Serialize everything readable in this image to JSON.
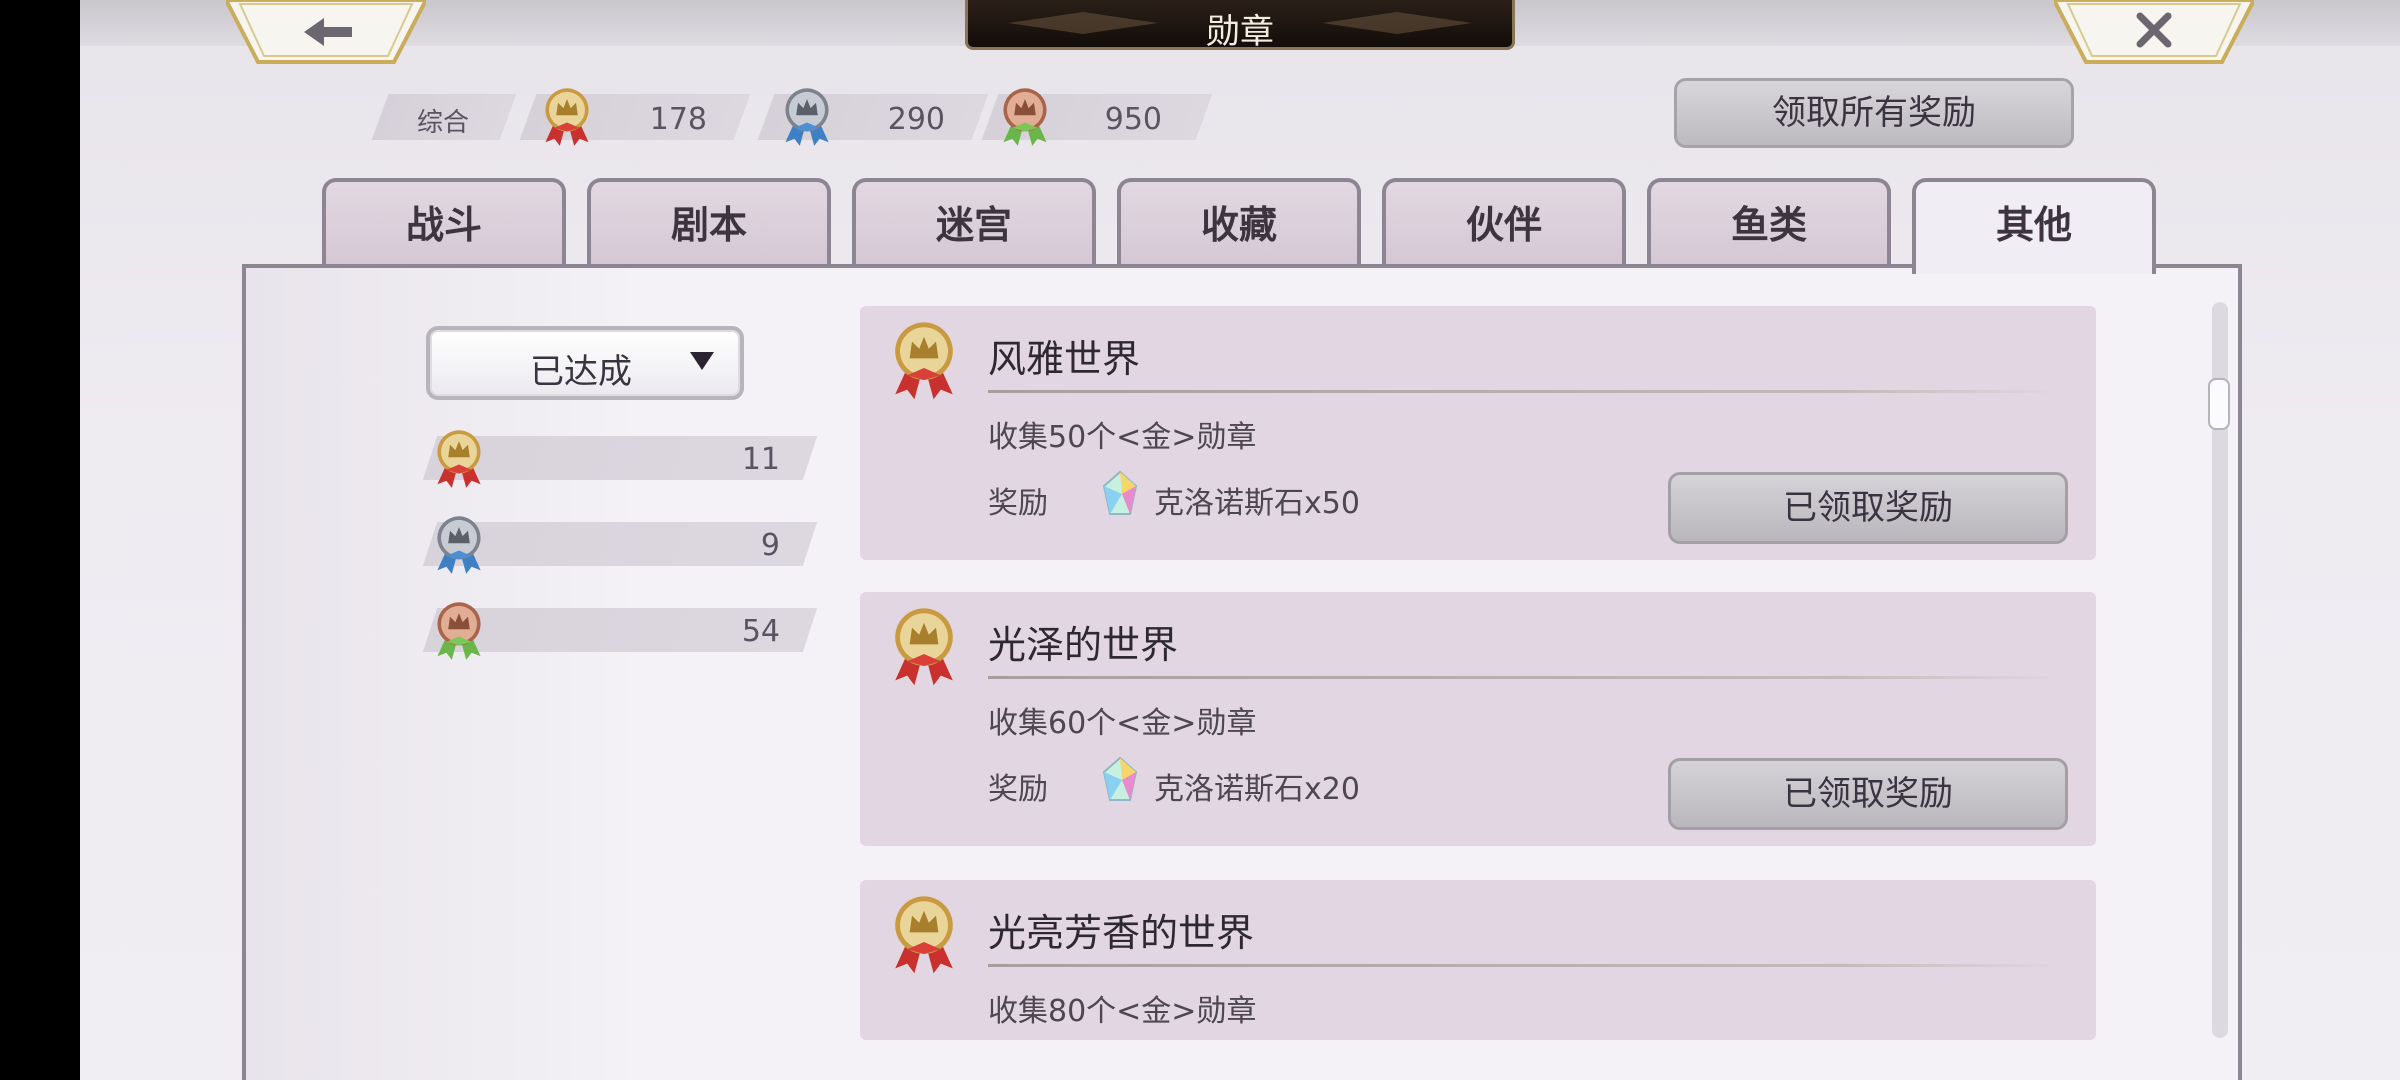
{
  "title": "勋章",
  "summary": {
    "label": "综合",
    "gold": "178",
    "silver": "290",
    "bronze": "950"
  },
  "claim_all_label": "领取所有奖励",
  "tabs": [
    {
      "label": "战斗"
    },
    {
      "label": "剧本"
    },
    {
      "label": "迷宫"
    },
    {
      "label": "收藏"
    },
    {
      "label": "伙伴"
    },
    {
      "label": "鱼类"
    },
    {
      "label": "其他"
    }
  ],
  "active_tab": "其他",
  "filter": {
    "selected": "已达成"
  },
  "counts": {
    "gold": "11",
    "silver": "9",
    "bronze": "54"
  },
  "achievements": [
    {
      "title": "风雅世界",
      "desc": "收集50个<金>勋章",
      "reward_label": "奖励",
      "reward": "克洛诺斯石x50",
      "button": "已领取奖励"
    },
    {
      "title": "光泽的世界",
      "desc": "收集60个<金>勋章",
      "reward_label": "奖励",
      "reward": "克洛诺斯石x20",
      "button": "已领取奖励"
    },
    {
      "title": "光亮芳香的世界",
      "desc": "收集80个<金>勋章"
    }
  ],
  "colors": {
    "gold_medal": "#d8b45a",
    "silver_medal": "#9ea3ad",
    "bronze_medal": "#c98a6e",
    "red_ribbon": "#c8312e",
    "blue_ribbon": "#3f7fc4",
    "green_ribbon": "#6bb64a"
  },
  "icons": [
    "back-arrow-icon",
    "close-icon",
    "gold-medal-icon",
    "silver-medal-icon",
    "bronze-medal-icon",
    "chevron-down-icon",
    "chronos-stone-icon"
  ]
}
